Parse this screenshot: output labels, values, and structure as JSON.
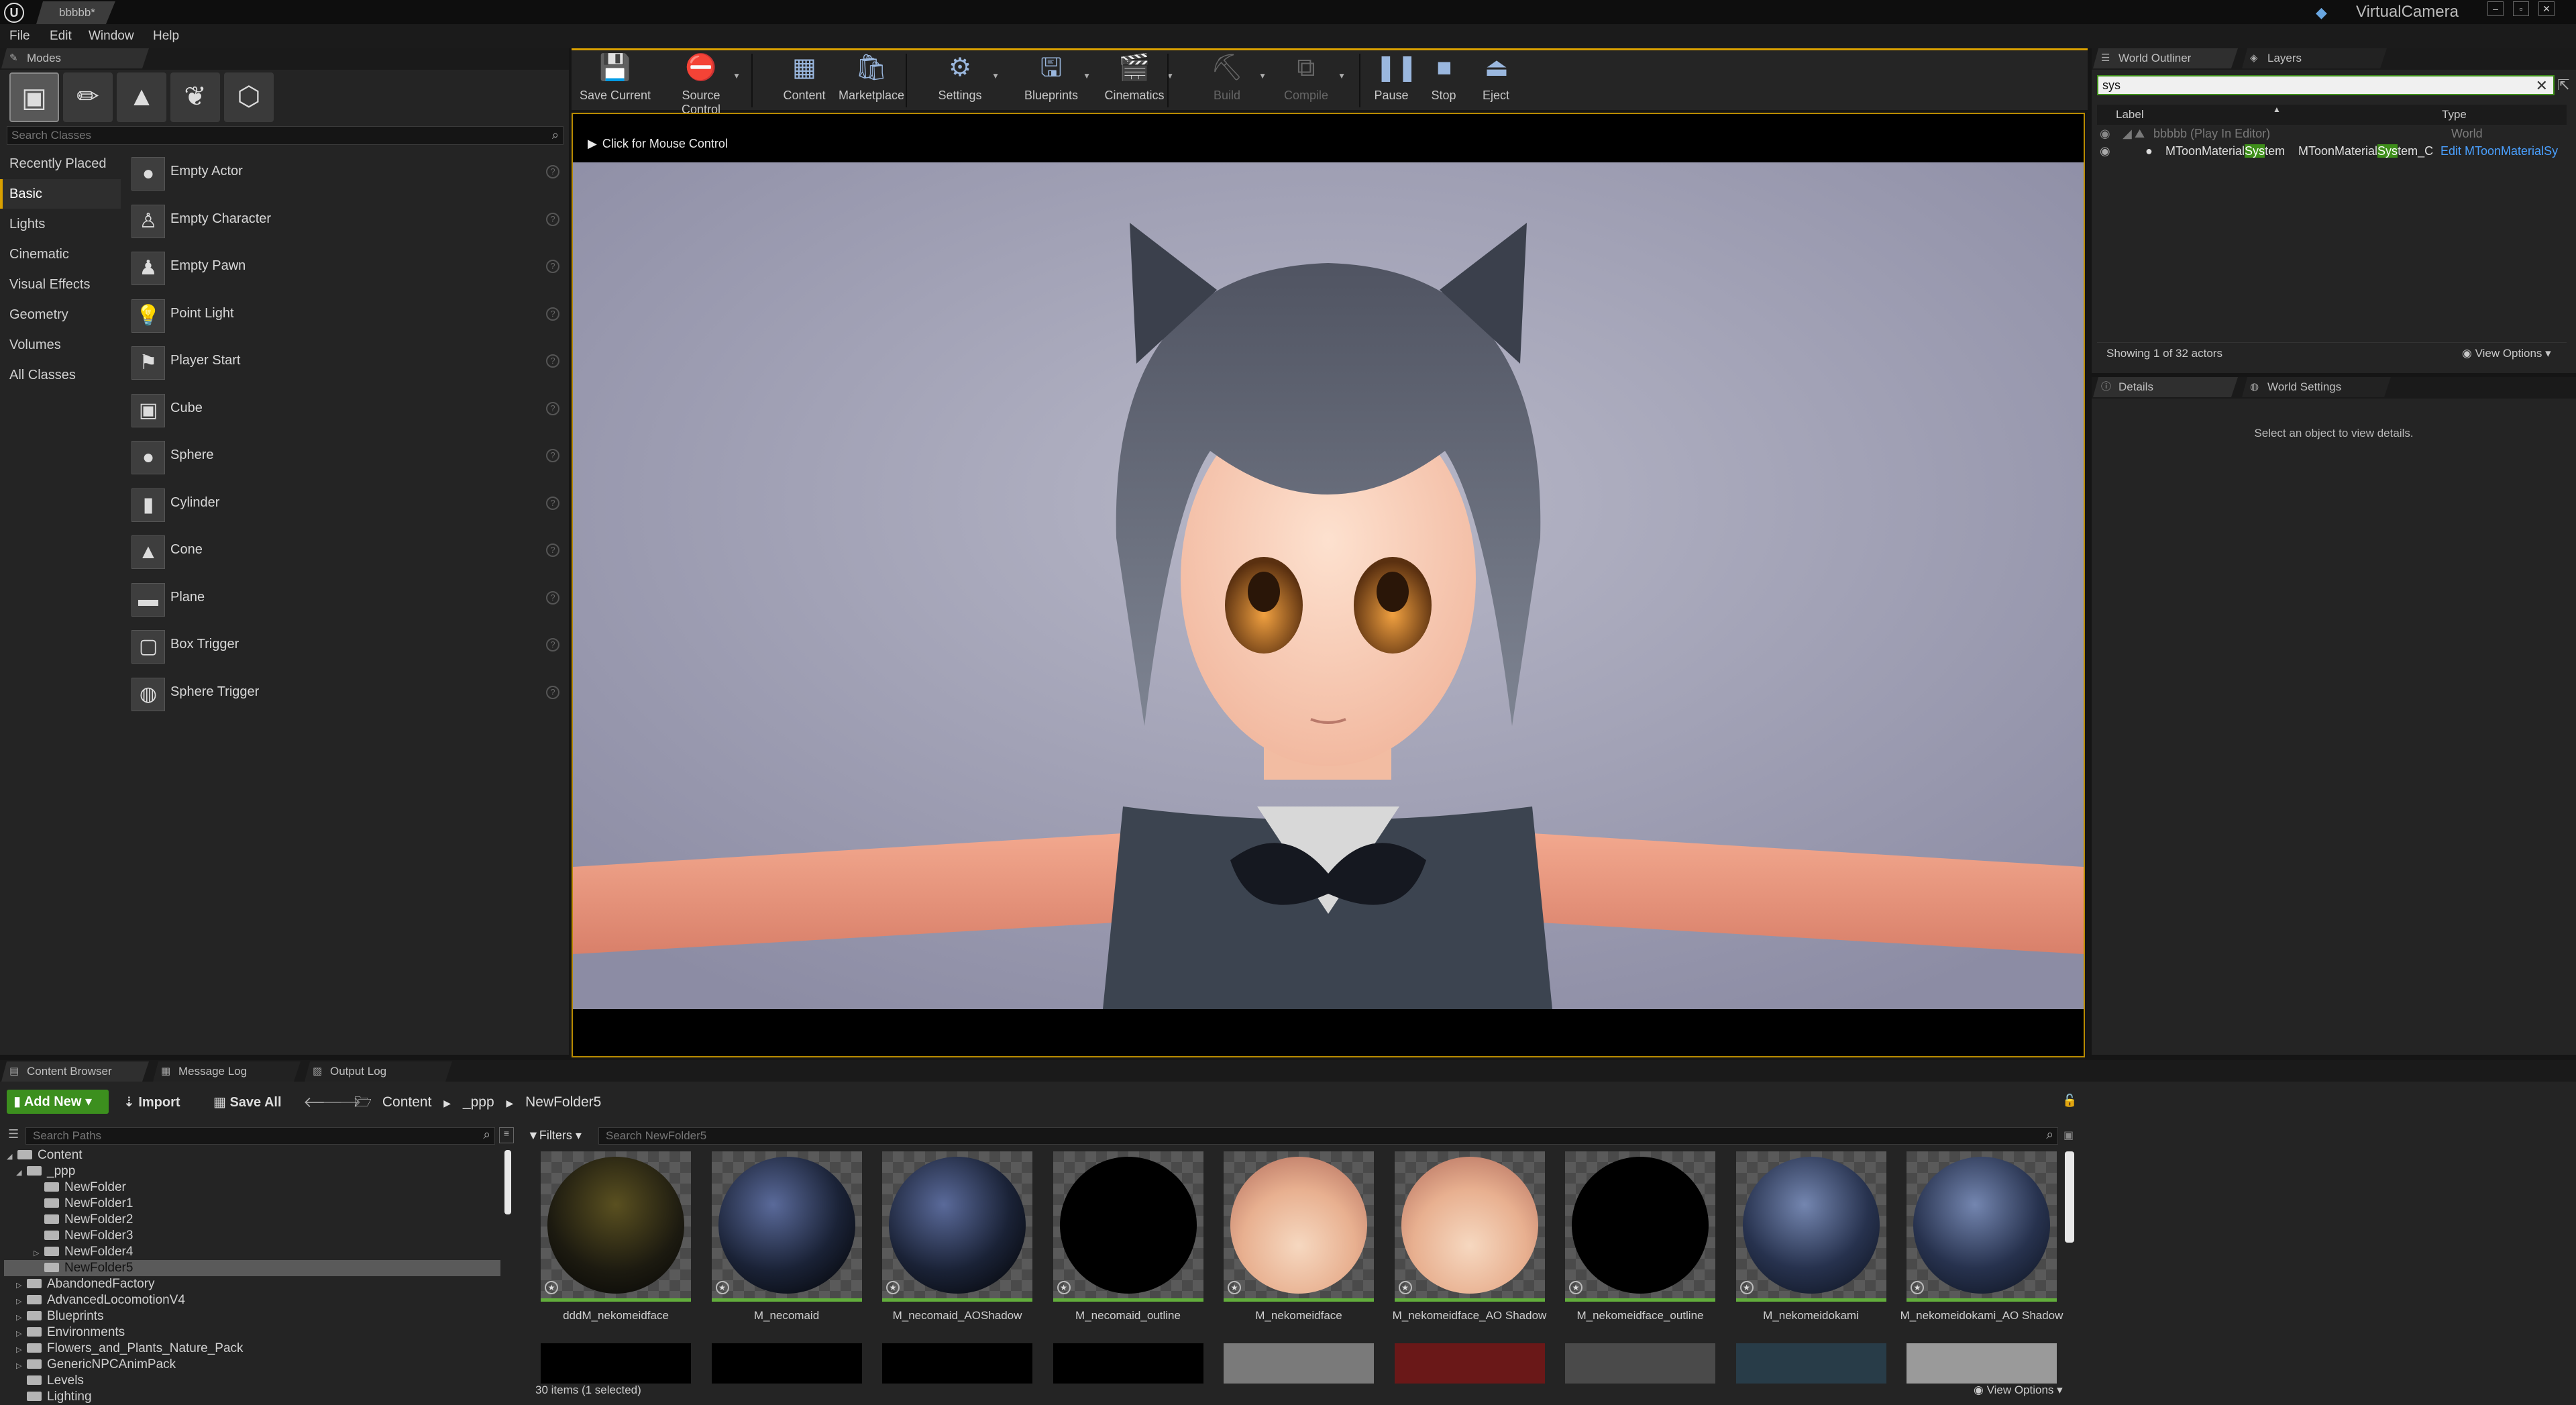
{
  "titlebar": {
    "document_tab": "bbbbb*",
    "project_name": "VirtualCamera",
    "window_buttons": [
      "minimize",
      "maximize",
      "close"
    ]
  },
  "menu": [
    "File",
    "Edit",
    "Window",
    "Help"
  ],
  "modes_panel": {
    "tab_label": "Modes",
    "mode_icons": [
      "place-icon",
      "paint-icon",
      "landscape-icon",
      "foliage-icon",
      "geometry-icon"
    ],
    "search_placeholder": "Search Classes",
    "categories": [
      "Recently Placed",
      "Basic",
      "Lights",
      "Cinematic",
      "Visual Effects",
      "Geometry",
      "Volumes",
      "All Classes"
    ],
    "selected_category": "Basic",
    "actors": [
      {
        "label": "Empty Actor",
        "icon": "sphere-icon"
      },
      {
        "label": "Empty Character",
        "icon": "character-icon"
      },
      {
        "label": "Empty Pawn",
        "icon": "pawn-icon"
      },
      {
        "label": "Point Light",
        "icon": "light-bulb-icon"
      },
      {
        "label": "Player Start",
        "icon": "player-start-icon"
      },
      {
        "label": "Cube",
        "icon": "cube-icon"
      },
      {
        "label": "Sphere",
        "icon": "sphere-icon"
      },
      {
        "label": "Cylinder",
        "icon": "cylinder-icon"
      },
      {
        "label": "Cone",
        "icon": "cone-icon"
      },
      {
        "label": "Plane",
        "icon": "plane-icon"
      },
      {
        "label": "Box Trigger",
        "icon": "box-trigger-icon"
      },
      {
        "label": "Sphere Trigger",
        "icon": "sphere-trigger-icon"
      }
    ]
  },
  "toolbar": {
    "buttons": [
      {
        "label": "Save Current",
        "icon": "save-icon",
        "dropdown": false,
        "enabled": true
      },
      {
        "label": "Source Control",
        "icon": "source-control-icon",
        "dropdown": true,
        "enabled": true
      },
      {
        "label": "Content",
        "icon": "content-icon",
        "dropdown": false,
        "enabled": true
      },
      {
        "label": "Marketplace",
        "icon": "marketplace-icon",
        "dropdown": false,
        "enabled": true
      },
      {
        "label": "Settings",
        "icon": "settings-icon",
        "dropdown": true,
        "enabled": true
      },
      {
        "label": "Blueprints",
        "icon": "blueprints-icon",
        "dropdown": true,
        "enabled": true
      },
      {
        "label": "Cinematics",
        "icon": "cinematics-icon",
        "dropdown": true,
        "enabled": true
      },
      {
        "label": "Build",
        "icon": "build-icon",
        "dropdown": true,
        "enabled": false
      },
      {
        "label": "Compile",
        "icon": "compile-icon",
        "dropdown": true,
        "enabled": false
      },
      {
        "label": "Pause",
        "icon": "pause-icon",
        "dropdown": false,
        "enabled": true
      },
      {
        "label": "Stop",
        "icon": "stop-icon",
        "dropdown": false,
        "enabled": true
      },
      {
        "label": "Eject",
        "icon": "eject-icon",
        "dropdown": false,
        "enabled": true
      }
    ]
  },
  "viewport": {
    "mouse_hint": "Click for Mouse Control"
  },
  "outliner": {
    "tabs": [
      "World Outliner",
      "Layers"
    ],
    "search_value": "sys",
    "columns": [
      "Label",
      "Type"
    ],
    "rows": [
      {
        "label": "bbbbb (Play In Editor)",
        "type": "World"
      },
      {
        "label_pre": "MToonMaterial",
        "label_hl": "Sys",
        "label_post": "tem",
        "type_pre": "MToonMaterial",
        "type_hl": "Sys",
        "type_post": "tem_C",
        "edit_link": "Edit MToonMaterialSy"
      }
    ],
    "status": "Showing 1 of 32 actors",
    "view_options": "View Options"
  },
  "details": {
    "tabs": [
      "Details",
      "World Settings"
    ],
    "empty_message": "Select an object to view details."
  },
  "bottom_tabs": [
    "Content Browser",
    "Message Log",
    "Output Log"
  ],
  "content_browser": {
    "add_new": "Add New",
    "import": "Import",
    "save_all": "Save All",
    "breadcrumb": [
      "Content",
      "_ppp",
      "NewFolder5"
    ],
    "search_paths_placeholder": "Search Paths",
    "filters": "Filters",
    "search_assets_placeholder": "Search NewFolder5",
    "tree": [
      {
        "label": "Content",
        "depth": 0,
        "expanded": true
      },
      {
        "label": "_ppp",
        "depth": 1,
        "expanded": true
      },
      {
        "label": "NewFolder",
        "depth": 2
      },
      {
        "label": "NewFolder1",
        "depth": 2
      },
      {
        "label": "NewFolder2",
        "depth": 2
      },
      {
        "label": "NewFolder3",
        "depth": 2
      },
      {
        "label": "NewFolder4",
        "depth": 2,
        "collapsed": true
      },
      {
        "label": "NewFolder5",
        "depth": 2,
        "selected": true
      },
      {
        "label": "AbandonedFactory",
        "depth": 1,
        "collapsed": true
      },
      {
        "label": "AdvancedLocomotionV4",
        "depth": 1,
        "collapsed": true
      },
      {
        "label": "Blueprints",
        "depth": 1,
        "collapsed": true
      },
      {
        "label": "Environments",
        "depth": 1,
        "collapsed": true
      },
      {
        "label": "Flowers_and_Plants_Nature_Pack",
        "depth": 1,
        "collapsed": true
      },
      {
        "label": "GenericNPCAnimPack",
        "depth": 1,
        "collapsed": true
      },
      {
        "label": "Levels",
        "depth": 1
      },
      {
        "label": "Lighting",
        "depth": 1
      }
    ],
    "assets": [
      {
        "label": "dddM_nekomeidface",
        "style": "dark-yellow"
      },
      {
        "label": "M_necomaid",
        "style": "dark-blue-cut"
      },
      {
        "label": "M_necomaid_AOShadow",
        "style": "dark-blue-cut"
      },
      {
        "label": "M_necomaid_outline",
        "style": "black"
      },
      {
        "label": "M_nekomeidface",
        "style": "face"
      },
      {
        "label": "M_nekomeidface_AO Shadow",
        "style": "face"
      },
      {
        "label": "M_nekomeidface_outline",
        "style": "black"
      },
      {
        "label": "M_nekomeidokami",
        "style": "hair-blue"
      },
      {
        "label": "M_nekomeidokami_AO Shadow",
        "style": "hair-blue"
      }
    ],
    "item_count": "30 items (1 selected)",
    "view_options": "View Options"
  }
}
